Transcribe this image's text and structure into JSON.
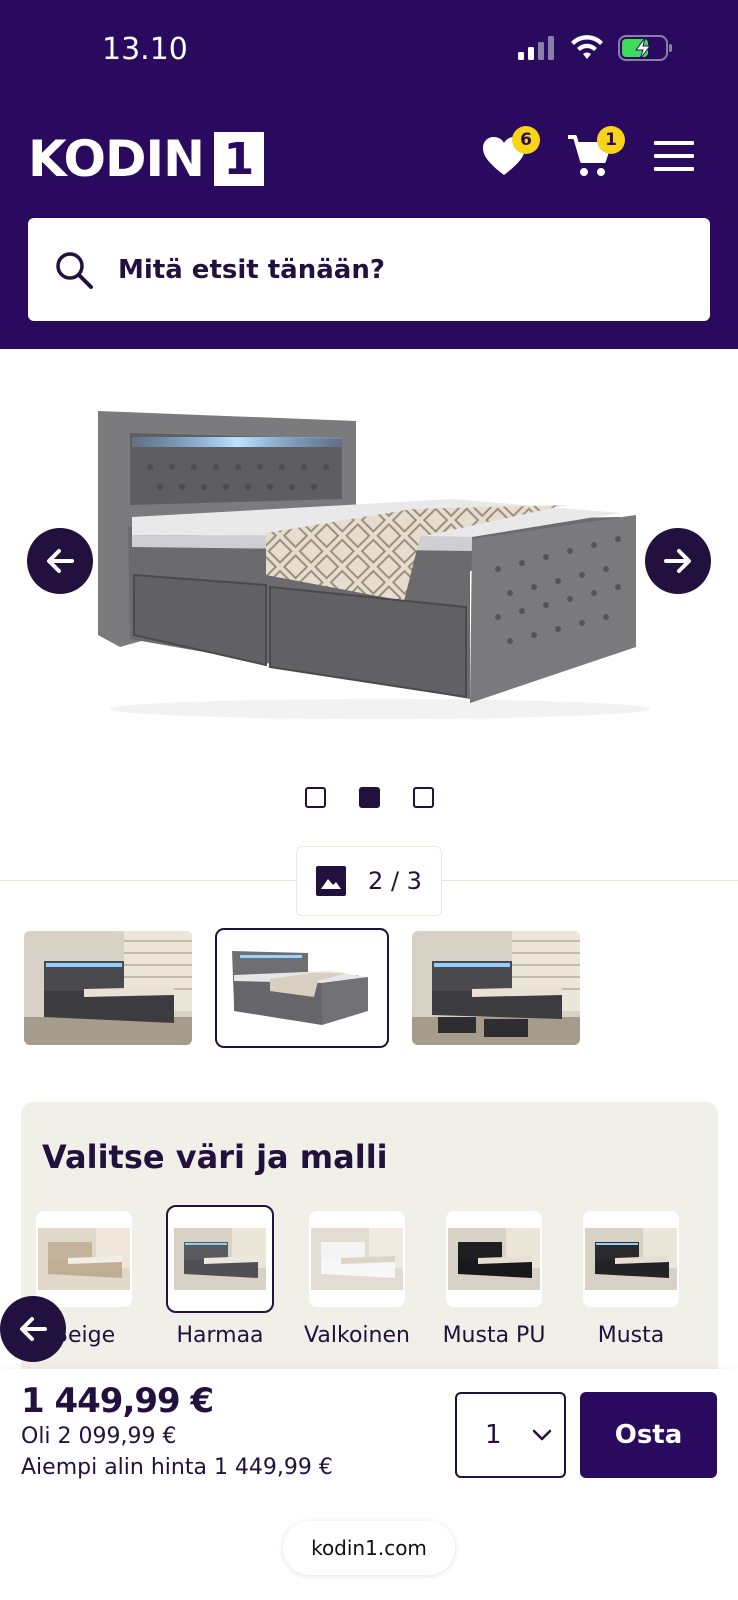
{
  "status_bar": {
    "time": "13.10"
  },
  "header": {
    "logo_word": "KODIN",
    "logo_number": "1",
    "wishlist_count": "6",
    "cart_count": "1"
  },
  "search": {
    "placeholder": "Mitä etsit tänään?"
  },
  "gallery": {
    "counter": "2 / 3",
    "current": 2,
    "total": 3
  },
  "variants": {
    "title": "Valitse väri ja malli",
    "items": [
      {
        "label": "Beige"
      },
      {
        "label": "Harmaa"
      },
      {
        "label": "Valkoinen"
      },
      {
        "label": "Musta PU"
      },
      {
        "label": "Musta"
      }
    ]
  },
  "buybar": {
    "price": "1 449,99 €",
    "old_price": "Oli 2 099,99 €",
    "lowest_price": "Aiempi alin hinta 1 449,99 €",
    "quantity": "1",
    "buy_label": "Osta",
    "url": "kodin1.com"
  },
  "colors": {
    "brand": "#2a0a5e",
    "badge": "#f7d417",
    "panel": "#f0efe8"
  }
}
